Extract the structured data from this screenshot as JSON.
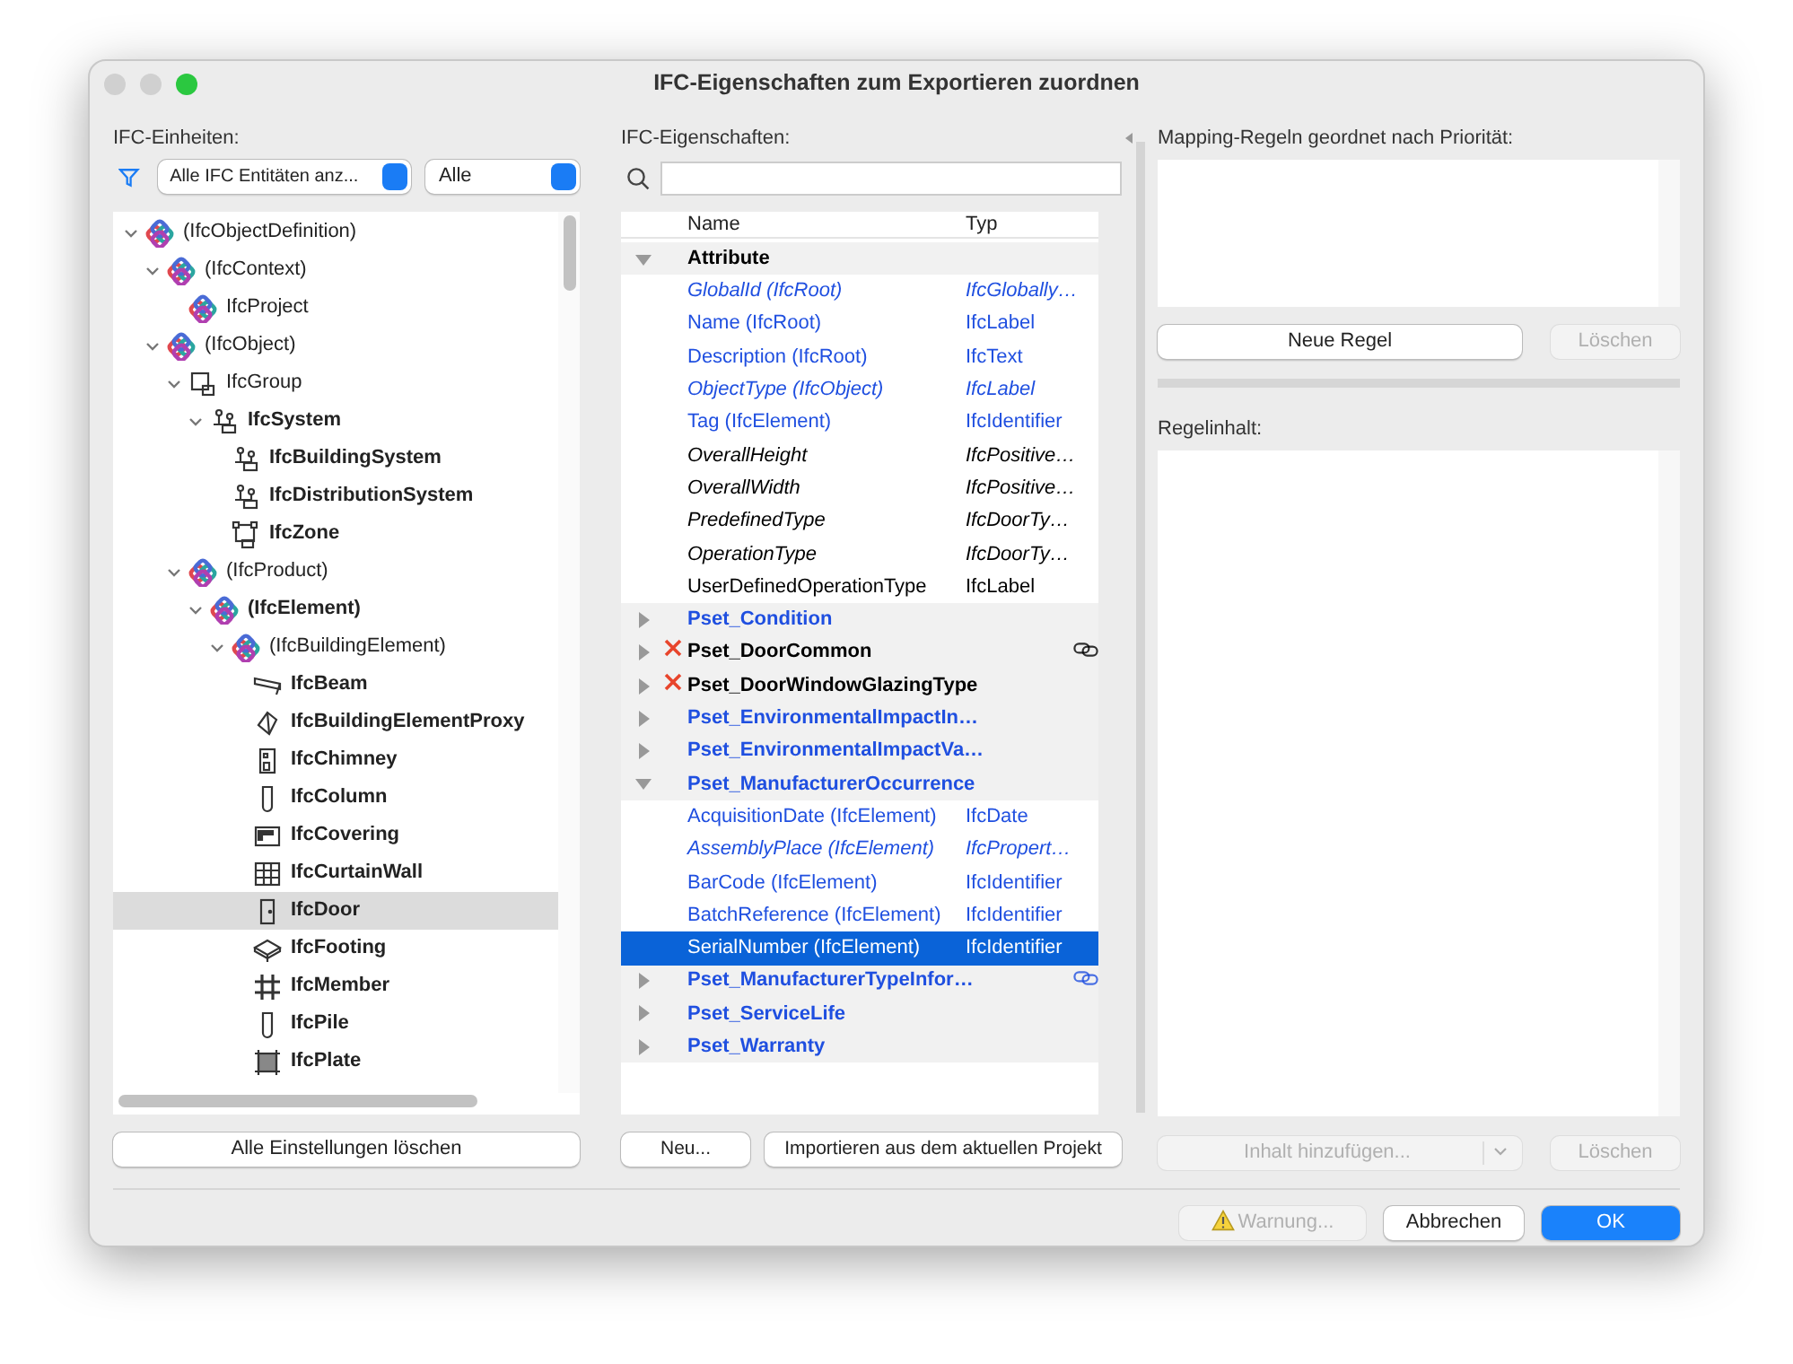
{
  "window": {
    "title": "IFC-Eigenschaften zum Exportieren zuordnen"
  },
  "units": {
    "label": "IFC-Einheiten:",
    "filter": "Alle IFC Entitäten anz...",
    "scope": "Alle",
    "tree": [
      {
        "label": "(IfcObjectDefinition)",
        "kind": "ifc",
        "bold": false,
        "expanded": true,
        "selected": false,
        "children": [
          {
            "label": "(IfcContext)",
            "kind": "ifc",
            "bold": false,
            "expanded": true,
            "selected": false,
            "children": [
              {
                "label": "IfcProject",
                "kind": "ifc",
                "bold": false,
                "selected": false
              }
            ]
          },
          {
            "label": "(IfcObject)",
            "kind": "ifc",
            "bold": false,
            "expanded": true,
            "selected": false,
            "children": [
              {
                "label": "IfcGroup",
                "kind": "group",
                "bold": false,
                "expanded": true,
                "selected": false,
                "children": [
                  {
                    "label": "IfcSystem",
                    "kind": "system",
                    "bold": true,
                    "expanded": true,
                    "selected": false,
                    "children": [
                      {
                        "label": "IfcBuildingSystem",
                        "kind": "system",
                        "bold": true,
                        "selected": false
                      },
                      {
                        "label": "IfcDistributionSystem",
                        "kind": "system",
                        "bold": true,
                        "selected": false
                      },
                      {
                        "label": "IfcZone",
                        "kind": "zone",
                        "bold": true,
                        "selected": false
                      }
                    ]
                  }
                ]
              },
              {
                "label": "(IfcProduct)",
                "kind": "ifc",
                "bold": false,
                "expanded": true,
                "selected": false,
                "children": [
                  {
                    "label": "(IfcElement)",
                    "kind": "ifc",
                    "bold": true,
                    "expanded": true,
                    "selected": false,
                    "children": [
                      {
                        "label": "(IfcBuildingElement)",
                        "kind": "ifc",
                        "bold": false,
                        "expanded": true,
                        "selected": false,
                        "children": [
                          {
                            "label": "IfcBeam",
                            "kind": "beam",
                            "bold": true,
                            "selected": false
                          },
                          {
                            "label": "IfcBuildingElementProxy",
                            "kind": "proxy",
                            "bold": true,
                            "selected": false
                          },
                          {
                            "label": "IfcChimney",
                            "kind": "chimney",
                            "bold": true,
                            "selected": false
                          },
                          {
                            "label": "IfcColumn",
                            "kind": "column",
                            "bold": true,
                            "selected": false
                          },
                          {
                            "label": "IfcCovering",
                            "kind": "covering",
                            "bold": true,
                            "selected": false
                          },
                          {
                            "label": "IfcCurtainWall",
                            "kind": "curtain",
                            "bold": true,
                            "selected": false
                          },
                          {
                            "label": "IfcDoor",
                            "kind": "door",
                            "bold": true,
                            "selected": true
                          },
                          {
                            "label": "IfcFooting",
                            "kind": "footing",
                            "bold": true,
                            "selected": false
                          },
                          {
                            "label": "IfcMember",
                            "kind": "member",
                            "bold": true,
                            "selected": false
                          },
                          {
                            "label": "IfcPile",
                            "kind": "column",
                            "bold": true,
                            "selected": false
                          },
                          {
                            "label": "IfcPlate",
                            "kind": "plate",
                            "bold": true,
                            "selected": false
                          }
                        ]
                      }
                    ]
                  }
                ]
              }
            ]
          }
        ]
      }
    ],
    "button": "Alle Einstellungen löschen"
  },
  "properties": {
    "label": "IFC-Eigenschaften:",
    "columns": [
      "Name",
      "Typ"
    ],
    "rows": [
      {
        "kind": "group",
        "name": "Attribute",
        "color": "#000000",
        "expanded": true,
        "excluded": false,
        "linked": false
      },
      {
        "kind": "property",
        "name": "GlobalId (IfcRoot)",
        "type": "IfcGlobally…",
        "color": "#1f4fe0",
        "italic": true,
        "selected": false
      },
      {
        "kind": "property",
        "name": "Name (IfcRoot)",
        "type": "IfcLabel",
        "color": "#1f4fe0",
        "italic": false,
        "selected": false
      },
      {
        "kind": "property",
        "name": "Description (IfcRoot)",
        "type": "IfcText",
        "color": "#1f4fe0",
        "italic": false,
        "selected": false
      },
      {
        "kind": "property",
        "name": "ObjectType (IfcObject)",
        "type": "IfcLabel",
        "color": "#1f4fe0",
        "italic": true,
        "selected": false
      },
      {
        "kind": "property",
        "name": "Tag (IfcElement)",
        "type": "IfcIdentifier",
        "color": "#1f4fe0",
        "italic": false,
        "selected": false
      },
      {
        "kind": "property",
        "name": "OverallHeight",
        "type": "IfcPositive…",
        "color": "#000000",
        "italic": true,
        "selected": false
      },
      {
        "kind": "property",
        "name": "OverallWidth",
        "type": "IfcPositive…",
        "color": "#000000",
        "italic": true,
        "selected": false
      },
      {
        "kind": "property",
        "name": "PredefinedType",
        "type": "IfcDoorTy…",
        "color": "#000000",
        "italic": true,
        "selected": false
      },
      {
        "kind": "property",
        "name": "OperationType",
        "type": "IfcDoorTy…",
        "color": "#000000",
        "italic": true,
        "selected": false
      },
      {
        "kind": "property",
        "name": "UserDefinedOperationType",
        "type": "IfcLabel",
        "color": "#000000",
        "italic": false,
        "selected": false
      },
      {
        "kind": "group",
        "name": "Pset_Condition",
        "color": "#1f4fe0",
        "expanded": false,
        "excluded": false,
        "linked": false
      },
      {
        "kind": "group",
        "name": "Pset_DoorCommon",
        "color": "#000000",
        "expanded": false,
        "excluded": true,
        "linked": true
      },
      {
        "kind": "group",
        "name": "Pset_DoorWindowGlazingType",
        "color": "#000000",
        "expanded": false,
        "excluded": true,
        "linked": false
      },
      {
        "kind": "group",
        "name": "Pset_EnvironmentalImpactIn…",
        "color": "#1f4fe0",
        "expanded": false,
        "excluded": false,
        "linked": false
      },
      {
        "kind": "group",
        "name": "Pset_EnvironmentalImpactVa…",
        "color": "#1f4fe0",
        "expanded": false,
        "excluded": false,
        "linked": false
      },
      {
        "kind": "group",
        "name": "Pset_ManufacturerOccurrence",
        "color": "#1f4fe0",
        "expanded": true,
        "excluded": false,
        "linked": false
      },
      {
        "kind": "property",
        "name": "AcquisitionDate (IfcElement)",
        "type": "IfcDate",
        "color": "#1f4fe0",
        "italic": false,
        "selected": false
      },
      {
        "kind": "property",
        "name": "AssemblyPlace (IfcElement)",
        "type": "IfcPropert…",
        "color": "#1f4fe0",
        "italic": true,
        "selected": false
      },
      {
        "kind": "property",
        "name": "BarCode (IfcElement)",
        "type": "IfcIdentifier",
        "color": "#1f4fe0",
        "italic": false,
        "selected": false
      },
      {
        "kind": "property",
        "name": "BatchReference (IfcElement)",
        "type": "IfcIdentifier",
        "color": "#1f4fe0",
        "italic": false,
        "selected": false
      },
      {
        "kind": "property",
        "name": "SerialNumber (IfcElement)",
        "type": "IfcIdentifier",
        "italic": false,
        "selected": true
      },
      {
        "kind": "group",
        "name": "Pset_ManufacturerTypeInfor…",
        "color": "#1f4fe0",
        "expanded": false,
        "excluded": false,
        "linked": true
      },
      {
        "kind": "group",
        "name": "Pset_ServiceLife",
        "color": "#1f4fe0",
        "expanded": false,
        "excluded": false,
        "linked": false
      },
      {
        "kind": "group",
        "name": "Pset_Warranty",
        "color": "#1f4fe0",
        "expanded": false,
        "excluded": false,
        "linked": false
      }
    ],
    "buttons": [
      {
        "label": "Neu...",
        "disabled": false
      },
      {
        "label": "Importieren aus dem aktuellen Projekt",
        "disabled": false
      }
    ]
  },
  "rules": {
    "label": "Mapping-Regeln geordnet nach Priorität:",
    "buttons": [
      {
        "label": "Neue Regel",
        "disabled": false
      },
      {
        "label": "Löschen",
        "disabled": true
      }
    ],
    "content_label": "Regelinhalt:",
    "add": {
      "label": "Inhalt hinzufügen...",
      "disabled": true
    },
    "delete": {
      "label": "Löschen",
      "disabled": true
    }
  },
  "footer": [
    {
      "kind": "warning",
      "label": "Warnung...",
      "disabled": true
    },
    {
      "kind": "plain",
      "label": "Abbrechen",
      "disabled": false
    },
    {
      "kind": "primary",
      "label": "OK",
      "disabled": false
    }
  ]
}
